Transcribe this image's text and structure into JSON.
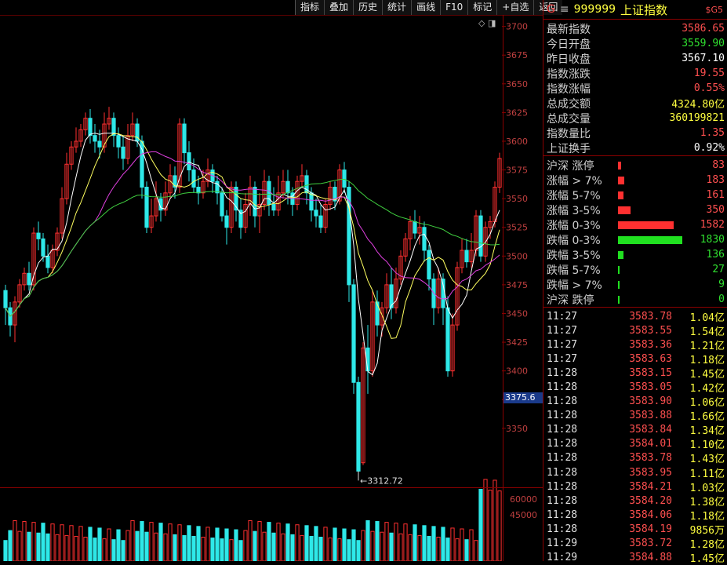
{
  "toolbar": [
    "指标",
    "叠加",
    "历史",
    "统计",
    "画线",
    "F10",
    "标记",
    "+自选",
    "返回"
  ],
  "chart": {
    "corner_icons": "◇ ◨",
    "price_axis": [
      "3700",
      "3675",
      "3650",
      "3625",
      "3600",
      "3575",
      "3550",
      "3525",
      "3500",
      "3475",
      "3450",
      "3425",
      "3400",
      "3375",
      "3350"
    ],
    "current_price_tag": "3375.6",
    "low_marker": "3312.72",
    "volume_axis": [
      "60000",
      "45000"
    ],
    "colors": {
      "up": "#ff3030",
      "down": "#2ee8e8",
      "ma5": "#ffffff",
      "ma10": "#ffff60",
      "ma20": "#e040e0",
      "ma60": "#40d040"
    }
  },
  "chart_data": {
    "type": "candlestick",
    "ylim": [
      3300,
      3710
    ],
    "low_label": 3312.72,
    "candles": [
      [
        3470,
        3455,
        3475,
        3440
      ],
      [
        3455,
        3440,
        3460,
        3430
      ],
      [
        3440,
        3460,
        3465,
        3425
      ],
      [
        3460,
        3475,
        3480,
        3455
      ],
      [
        3475,
        3485,
        3490,
        3470
      ],
      [
        3485,
        3475,
        3495,
        3470
      ],
      [
        3475,
        3520,
        3525,
        3470
      ],
      [
        3520,
        3515,
        3530,
        3505
      ],
      [
        3515,
        3500,
        3520,
        3495
      ],
      [
        3500,
        3490,
        3510,
        3485
      ],
      [
        3490,
        3505,
        3510,
        3485
      ],
      [
        3505,
        3520,
        3525,
        3500
      ],
      [
        3520,
        3550,
        3560,
        3515
      ],
      [
        3550,
        3580,
        3590,
        3545
      ],
      [
        3580,
        3595,
        3600,
        3575
      ],
      [
        3595,
        3600,
        3612,
        3590
      ],
      [
        3600,
        3610,
        3615,
        3595
      ],
      [
        3610,
        3620,
        3625,
        3605
      ],
      [
        3620,
        3605,
        3628,
        3598
      ],
      [
        3605,
        3600,
        3615,
        3590
      ],
      [
        3600,
        3595,
        3610,
        3585
      ],
      [
        3595,
        3615,
        3625,
        3590
      ],
      [
        3615,
        3620,
        3630,
        3610
      ],
      [
        3620,
        3605,
        3625,
        3595
      ],
      [
        3605,
        3595,
        3612,
        3585
      ],
      [
        3595,
        3585,
        3605,
        3575
      ],
      [
        3585,
        3605,
        3615,
        3580
      ],
      [
        3605,
        3615,
        3625,
        3600
      ],
      [
        3615,
        3600,
        3620,
        3595
      ],
      [
        3600,
        3560,
        3605,
        3550
      ],
      [
        3560,
        3525,
        3565,
        3520
      ],
      [
        3525,
        3535,
        3550,
        3520
      ],
      [
        3535,
        3550,
        3565,
        3530
      ],
      [
        3550,
        3540,
        3555,
        3530
      ],
      [
        3540,
        3555,
        3565,
        3535
      ],
      [
        3555,
        3570,
        3580,
        3550
      ],
      [
        3570,
        3560,
        3578,
        3550
      ],
      [
        3560,
        3615,
        3620,
        3555
      ],
      [
        3615,
        3590,
        3620,
        3580
      ],
      [
        3590,
        3575,
        3600,
        3565
      ],
      [
        3575,
        3560,
        3585,
        3555
      ],
      [
        3560,
        3555,
        3570,
        3545
      ],
      [
        3555,
        3565,
        3575,
        3550
      ],
      [
        3565,
        3575,
        3585,
        3560
      ],
      [
        3575,
        3565,
        3580,
        3555
      ],
      [
        3565,
        3555,
        3570,
        3545
      ],
      [
        3555,
        3535,
        3560,
        3530
      ],
      [
        3535,
        3525,
        3540,
        3510
      ],
      [
        3525,
        3560,
        3565,
        3520
      ],
      [
        3560,
        3540,
        3565,
        3530
      ],
      [
        3540,
        3525,
        3550,
        3515
      ],
      [
        3525,
        3545,
        3555,
        3520
      ],
      [
        3545,
        3560,
        3570,
        3535
      ],
      [
        3560,
        3535,
        3565,
        3525
      ],
      [
        3535,
        3545,
        3555,
        3520
      ],
      [
        3545,
        3565,
        3575,
        3540
      ],
      [
        3565,
        3545,
        3570,
        3535
      ],
      [
        3545,
        3540,
        3560,
        3535
      ],
      [
        3540,
        3555,
        3570,
        3535
      ],
      [
        3555,
        3565,
        3575,
        3550
      ],
      [
        3565,
        3555,
        3575,
        3545
      ],
      [
        3555,
        3545,
        3560,
        3535
      ],
      [
        3545,
        3565,
        3570,
        3540
      ],
      [
        3565,
        3570,
        3580,
        3560
      ],
      [
        3570,
        3555,
        3575,
        3545
      ],
      [
        3555,
        3540,
        3560,
        3530
      ],
      [
        3540,
        3535,
        3550,
        3525
      ],
      [
        3535,
        3525,
        3545,
        3520
      ],
      [
        3525,
        3545,
        3550,
        3520
      ],
      [
        3545,
        3560,
        3565,
        3540
      ],
      [
        3560,
        3548,
        3565,
        3540
      ],
      [
        3548,
        3575,
        3580,
        3545
      ],
      [
        3575,
        3560,
        3582,
        3555
      ],
      [
        3560,
        3475,
        3565,
        3460
      ],
      [
        3475,
        3390,
        3480,
        3380
      ],
      [
        3390,
        3312.72,
        3395,
        3312.72
      ],
      [
        3320,
        3420,
        3425,
        3318
      ],
      [
        3420,
        3400,
        3440,
        3380
      ],
      [
        3400,
        3460,
        3470,
        3395
      ],
      [
        3460,
        3440,
        3470,
        3430
      ],
      [
        3440,
        3455,
        3460,
        3430
      ],
      [
        3455,
        3475,
        3485,
        3450
      ],
      [
        3475,
        3455,
        3490,
        3445
      ],
      [
        3455,
        3480,
        3490,
        3450
      ],
      [
        3480,
        3500,
        3505,
        3475
      ],
      [
        3500,
        3515,
        3520,
        3495
      ],
      [
        3515,
        3530,
        3535,
        3505
      ],
      [
        3530,
        3520,
        3540,
        3515
      ],
      [
        3520,
        3525,
        3535,
        3510
      ],
      [
        3525,
        3505,
        3530,
        3495
      ],
      [
        3505,
        3480,
        3510,
        3470
      ],
      [
        3480,
        3455,
        3485,
        3440
      ],
      [
        3455,
        3480,
        3490,
        3450
      ],
      [
        3480,
        3455,
        3485,
        3440
      ],
      [
        3455,
        3400,
        3465,
        3395
      ],
      [
        3400,
        3440,
        3450,
        3395
      ],
      [
        3440,
        3490,
        3495,
        3435
      ],
      [
        3490,
        3505,
        3515,
        3485
      ],
      [
        3505,
        3495,
        3515,
        3490
      ],
      [
        3495,
        3505,
        3520,
        3490
      ],
      [
        3505,
        3535,
        3540,
        3500
      ],
      [
        3535,
        3500,
        3540,
        3495
      ],
      [
        3500,
        3525,
        3530,
        3495
      ],
      [
        3525,
        3530,
        3535,
        3515
      ],
      [
        3530,
        3560,
        3565,
        3525
      ],
      [
        3560,
        3585,
        3590,
        3555
      ]
    ],
    "series_names": [
      "MA5",
      "MA10",
      "MA20",
      "MA60"
    ]
  },
  "panel": {
    "header": {
      "g": "G",
      "menu": "≡",
      "code": "999999",
      "name": "上证指数",
      "tag": "$G5"
    },
    "quote": [
      {
        "label": "最新指数",
        "value": "3586.65",
        "color": "#ff5050"
      },
      {
        "label": "今日开盘",
        "value": "3559.90",
        "color": "#30e030"
      },
      {
        "label": "昨日收盘",
        "value": "3567.10",
        "color": "#ffffff"
      },
      {
        "label": "指数涨跌",
        "value": "19.55",
        "color": "#ff5050"
      },
      {
        "label": "指数涨幅",
        "value": "0.55%",
        "color": "#ff5050"
      },
      {
        "label": "总成交额",
        "value": "4324.80亿",
        "color": "#ffff40"
      },
      {
        "label": "总成交量",
        "value": "360199821",
        "color": "#ffff40"
      },
      {
        "label": "指数量比",
        "value": "1.35",
        "color": "#ff5050"
      },
      {
        "label": "上证换手",
        "value": "0.92%",
        "color": "#ffffff"
      }
    ],
    "breadth": [
      {
        "label": "沪深 涨停",
        "value": "83",
        "pct": 0.05,
        "color": "#ff3030"
      },
      {
        "label": "涨幅 > 7%",
        "value": "183",
        "pct": 0.1,
        "color": "#ff3030"
      },
      {
        "label": "涨幅 5-7%",
        "value": "161",
        "pct": 0.09,
        "color": "#ff3030"
      },
      {
        "label": "涨幅 3-5%",
        "value": "350",
        "pct": 0.19,
        "color": "#ff3030"
      },
      {
        "label": "涨幅 0-3%",
        "value": "1582",
        "pct": 0.86,
        "color": "#ff3030"
      },
      {
        "label": "跌幅 0-3%",
        "value": "1830",
        "pct": 1.0,
        "color": "#20e020"
      },
      {
        "label": "跌幅 3-5%",
        "value": "136",
        "pct": 0.08,
        "color": "#20e020"
      },
      {
        "label": "跌幅 5-7%",
        "value": "27",
        "pct": 0.015,
        "color": "#20e020"
      },
      {
        "label": "跌幅 > 7%",
        "value": "9",
        "pct": 0.01,
        "color": "#20e020"
      },
      {
        "label": "沪深 跌停",
        "value": "0",
        "pct": 0.01,
        "color": "#20e020"
      }
    ],
    "ticks": [
      {
        "time": "11:27",
        "price": "3583.78",
        "vol": "1.04",
        "unit": "亿"
      },
      {
        "time": "11:27",
        "price": "3583.55",
        "vol": "1.54",
        "unit": "亿"
      },
      {
        "time": "11:27",
        "price": "3583.36",
        "vol": "1.21",
        "unit": "亿"
      },
      {
        "time": "11:27",
        "price": "3583.63",
        "vol": "1.18",
        "unit": "亿"
      },
      {
        "time": "11:28",
        "price": "3583.15",
        "vol": "1.45",
        "unit": "亿"
      },
      {
        "time": "11:28",
        "price": "3583.05",
        "vol": "1.42",
        "unit": "亿"
      },
      {
        "time": "11:28",
        "price": "3583.90",
        "vol": "1.06",
        "unit": "亿"
      },
      {
        "time": "11:28",
        "price": "3583.88",
        "vol": "1.66",
        "unit": "亿"
      },
      {
        "time": "11:28",
        "price": "3583.84",
        "vol": "1.34",
        "unit": "亿"
      },
      {
        "time": "11:28",
        "price": "3584.01",
        "vol": "1.10",
        "unit": "亿"
      },
      {
        "time": "11:28",
        "price": "3583.78",
        "vol": "1.43",
        "unit": "亿"
      },
      {
        "time": "11:28",
        "price": "3583.95",
        "vol": "1.11",
        "unit": "亿"
      },
      {
        "time": "11:28",
        "price": "3584.21",
        "vol": "1.03",
        "unit": "亿"
      },
      {
        "time": "11:28",
        "price": "3584.20",
        "vol": "1.38",
        "unit": "亿"
      },
      {
        "time": "11:28",
        "price": "3584.06",
        "vol": "1.18",
        "unit": "亿"
      },
      {
        "time": "11:28",
        "price": "3584.19",
        "vol": "9856",
        "unit": "万"
      },
      {
        "time": "11:29",
        "price": "3583.72",
        "vol": "1.28",
        "unit": "亿"
      },
      {
        "time": "11:29",
        "price": "3584.88",
        "vol": "1.45",
        "unit": "亿"
      }
    ]
  }
}
